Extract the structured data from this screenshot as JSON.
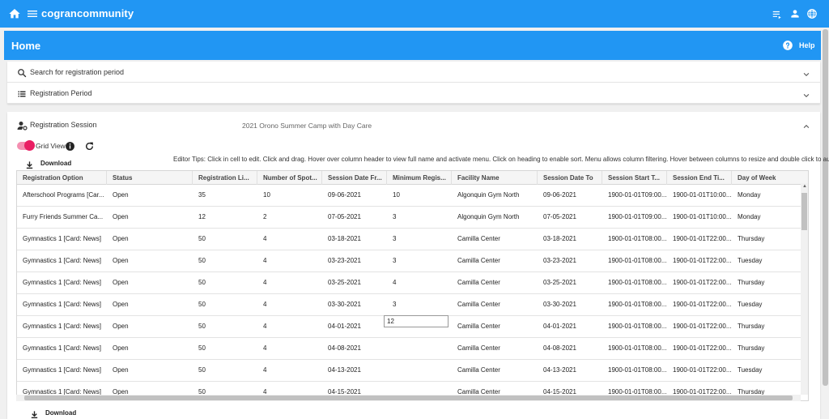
{
  "app": {
    "brand": "cograncommunity"
  },
  "header": {
    "title": "Home",
    "help": "Help"
  },
  "panels": {
    "search": "Search for registration period",
    "period": "Registration Period",
    "session": "Registration Session",
    "session_value": "2021 Orono Summer Camp with Day Care"
  },
  "grid_controls": {
    "grid_view": "Grid View",
    "download": "Download",
    "tips": "Editor Tips: Click in cell to edit. Click and drag. Hover over column header to view full name and activate menu. Click on heading to enable sort. Menu allows column filtering. Hover between columns to resize and double click to auto resize."
  },
  "columns": [
    "Registration Option",
    "Status",
    "Registration Li...",
    "Number of Spot...",
    "Session Date Fr...",
    "Minimum Regis...",
    "Facility Name",
    "Session Date To",
    "Session Start T...",
    "Session End Ti...",
    "Day of Week"
  ],
  "rows": [
    [
      "Afterschool Programs [Car...",
      "Open",
      "35",
      "10",
      "09-06-2021",
      "10",
      "Algonquin Gym North",
      "09-06-2021",
      "1900-01-01T09:00...",
      "1900-01-01T10:00...",
      "Monday"
    ],
    [
      "Furry Friends Summer Ca...",
      "Open",
      "12",
      "2",
      "07-05-2021",
      "3",
      "Algonquin Gym North",
      "07-05-2021",
      "1900-01-01T09:00...",
      "1900-01-01T10:00...",
      "Monday"
    ],
    [
      "Gymnastics 1 [Card: News]",
      "Open",
      "50",
      "4",
      "03-18-2021",
      "3",
      "Camilla Center",
      "03-18-2021",
      "1900-01-01T08:00...",
      "1900-01-01T22:00...",
      "Thursday"
    ],
    [
      "Gymnastics 1 [Card: News]",
      "Open",
      "50",
      "4",
      "03-23-2021",
      "3",
      "Camilla Center",
      "03-23-2021",
      "1900-01-01T08:00...",
      "1900-01-01T22:00...",
      "Tuesday"
    ],
    [
      "Gymnastics 1 [Card: News]",
      "Open",
      "50",
      "4",
      "03-25-2021",
      "4",
      "Camilla Center",
      "03-25-2021",
      "1900-01-01T08:00...",
      "1900-01-01T22:00...",
      "Thursday"
    ],
    [
      "Gymnastics 1 [Card: News]",
      "Open",
      "50",
      "4",
      "03-30-2021",
      "3",
      "Camilla Center",
      "03-30-2021",
      "1900-01-01T08:00...",
      "1900-01-01T22:00...",
      "Tuesday"
    ],
    [
      "Gymnastics 1 [Card: News]",
      "Open",
      "50",
      "4",
      "04-01-2021",
      "",
      "Camilla Center",
      "04-01-2021",
      "1900-01-01T08:00...",
      "1900-01-01T22:00...",
      "Thursday"
    ],
    [
      "Gymnastics 1 [Card: News]",
      "Open",
      "50",
      "4",
      "04-08-2021",
      "",
      "Camilla Center",
      "04-08-2021",
      "1900-01-01T08:00...",
      "1900-01-01T22:00...",
      "Thursday"
    ],
    [
      "Gymnastics 1 [Card: News]",
      "Open",
      "50",
      "4",
      "04-13-2021",
      "",
      "Camilla Center",
      "04-13-2021",
      "1900-01-01T08:00...",
      "1900-01-01T22:00...",
      "Tuesday"
    ],
    [
      "Gymnastics 1 [Card: News]",
      "Open",
      "50",
      "4",
      "04-15-2021",
      "",
      "Camilla Center",
      "04-15-2021",
      "1900-01-01T08:00...",
      "1900-01-01T22:00...",
      "Thursday"
    ]
  ],
  "editing": {
    "value": "12"
  }
}
